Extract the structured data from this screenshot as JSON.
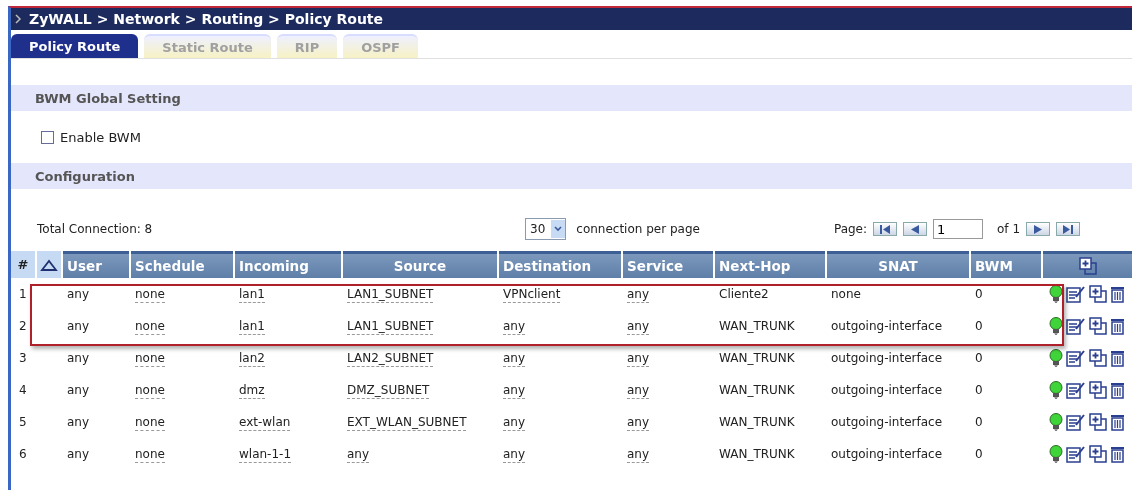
{
  "window": {
    "title": "ZyWALL > Network > Routing > Policy Route"
  },
  "tabs": [
    {
      "label": "Policy Route",
      "selected": true
    },
    {
      "label": "Static Route",
      "selected": false
    },
    {
      "label": "RIP",
      "selected": false
    },
    {
      "label": "OSPF",
      "selected": false
    }
  ],
  "bwm_section": {
    "title": "BWM Global Setting",
    "enable_bwm": {
      "label": "Enable BWM",
      "checked": false
    }
  },
  "config_section": {
    "title": "Configuration"
  },
  "toolbar": {
    "total": "Total Connection: 8",
    "per_page": "30",
    "per_page_label": "connection per page",
    "page_label": "Page:",
    "page": "1",
    "page_of": "of 1"
  },
  "table": {
    "number_header": "#",
    "columns": [
      {
        "label": "User",
        "underlined": false
      },
      {
        "label": "Schedule",
        "underlined": true
      },
      {
        "label": "Incoming",
        "underlined": true
      },
      {
        "label": "Source",
        "underlined": true
      },
      {
        "label": "Destination",
        "underlined": true
      },
      {
        "label": "Service",
        "underlined": true
      },
      {
        "label": "Next-Hop",
        "underlined": false
      },
      {
        "label": "SNAT",
        "underlined": false
      },
      {
        "label": "BWM",
        "underlined": false
      }
    ],
    "rows": [
      {
        "number": "1",
        "cells": [
          "any",
          "none",
          "lan1",
          "LAN1_SUBNET",
          "VPNclient",
          "any",
          "Cliente2",
          "none",
          "0"
        ],
        "active": true,
        "highlighted": true
      },
      {
        "number": "2",
        "cells": [
          "any",
          "none",
          "lan1",
          "LAN1_SUBNET",
          "any",
          "any",
          "WAN_TRUNK",
          "outgoing-interface",
          "0"
        ],
        "active": true,
        "highlighted": true
      },
      {
        "number": "3",
        "cells": [
          "any",
          "none",
          "lan2",
          "LAN2_SUBNET",
          "any",
          "any",
          "WAN_TRUNK",
          "outgoing-interface",
          "0"
        ],
        "active": true,
        "highlighted": false
      },
      {
        "number": "4",
        "cells": [
          "any",
          "none",
          "dmz",
          "DMZ_SUBNET",
          "any",
          "any",
          "WAN_TRUNK",
          "outgoing-interface",
          "0"
        ],
        "active": true,
        "highlighted": false
      },
      {
        "number": "5",
        "cells": [
          "any",
          "none",
          "ext-wlan",
          "EXT_WLAN_SUBNET",
          "any",
          "any",
          "WAN_TRUNK",
          "outgoing-interface",
          "0"
        ],
        "active": true,
        "highlighted": false
      },
      {
        "number": "6",
        "cells": [
          "any",
          "none",
          "wlan-1-1",
          "any",
          "any",
          "any",
          "WAN_TRUNK",
          "outgoing-interface",
          "0"
        ],
        "active": true,
        "highlighted": false
      }
    ]
  }
}
